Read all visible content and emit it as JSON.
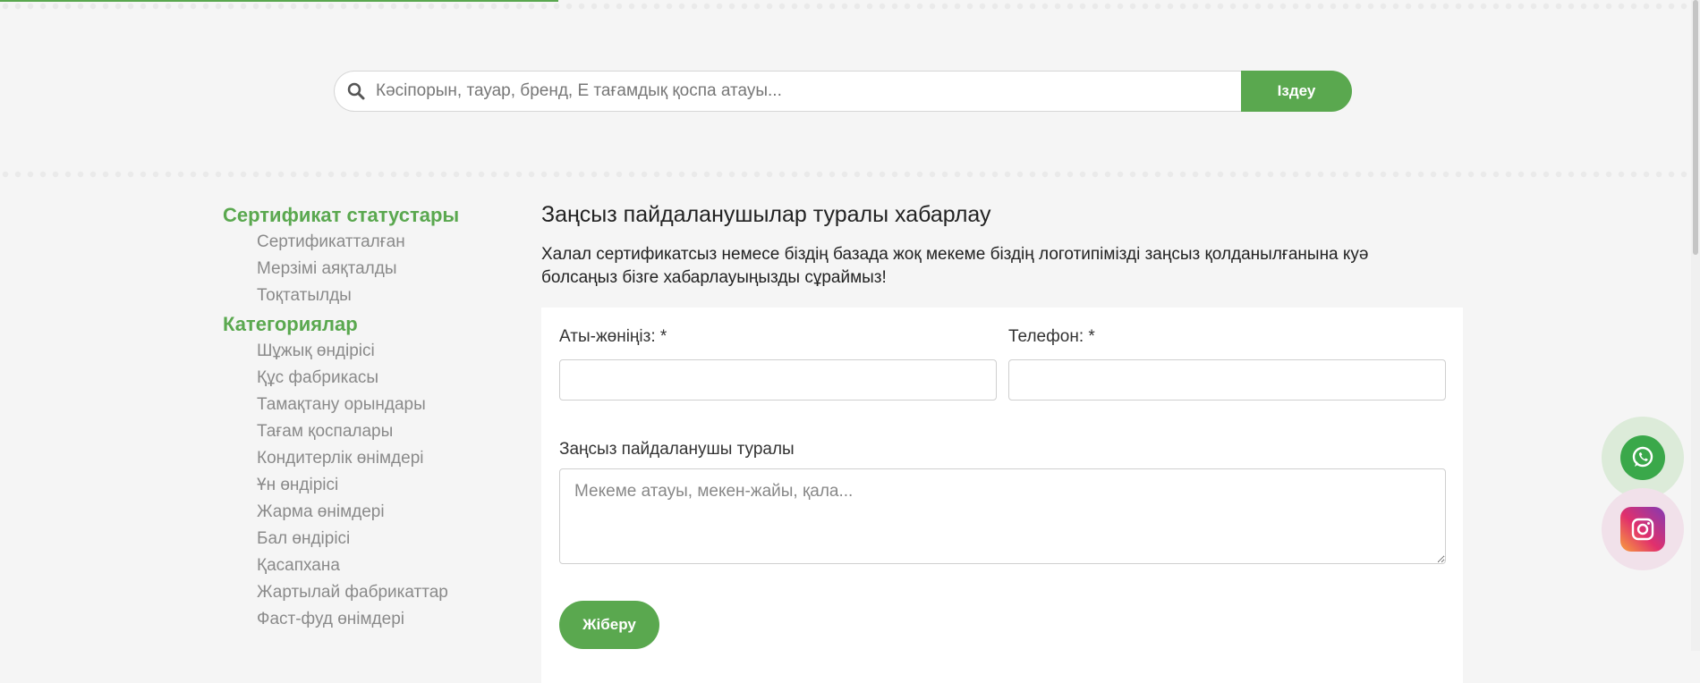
{
  "colors": {
    "accent": "#5aa84f",
    "background": "#f5f5f5",
    "muted_text": "#8a8a8a"
  },
  "search": {
    "placeholder": "Кәсіпорын, тауар, бренд, Е тағамдық қоспа атауы...",
    "button_label": "Іздеу",
    "icon": "search-icon"
  },
  "sidebar": {
    "sections": [
      {
        "title": "Сертификат статустары",
        "items": [
          "Сертификатталған",
          "Мерзімі аяқталды",
          "Тоқтатылды"
        ]
      },
      {
        "title": "Категориялар",
        "items": [
          "Шұжық өндірісі",
          "Құс фабрикасы",
          "Тамақтану орындары",
          "Тағам қоспалары",
          "Кондитерлік өнімдері",
          "Ұн өндірісі",
          "Жарма өнімдері",
          "Бал өндірісі",
          "Қасапхана",
          "Жартылай фабрикаттар",
          "Фаст-фуд өнімдері"
        ]
      }
    ]
  },
  "main": {
    "title": "Заңсыз пайдаланушылар туралы хабарлау",
    "description": "Халал сертификатсыз немесе біздің базада жоқ мекеме біздің логотипімізді заңсыз қолданылғанына куә болсаңыз бізге хабарлауыңызды сұраймыз!"
  },
  "form": {
    "name_label": "Аты-жөніңіз: *",
    "phone_label": "Телефон: *",
    "about_label": "Заңсыз пайдаланушы туралы",
    "about_placeholder": "Мекеме атауы, мекен-жайы, қала...",
    "submit_label": "Жіберу"
  },
  "floating": {
    "whatsapp_icon": "whatsapp-icon",
    "instagram_icon": "instagram-icon"
  }
}
